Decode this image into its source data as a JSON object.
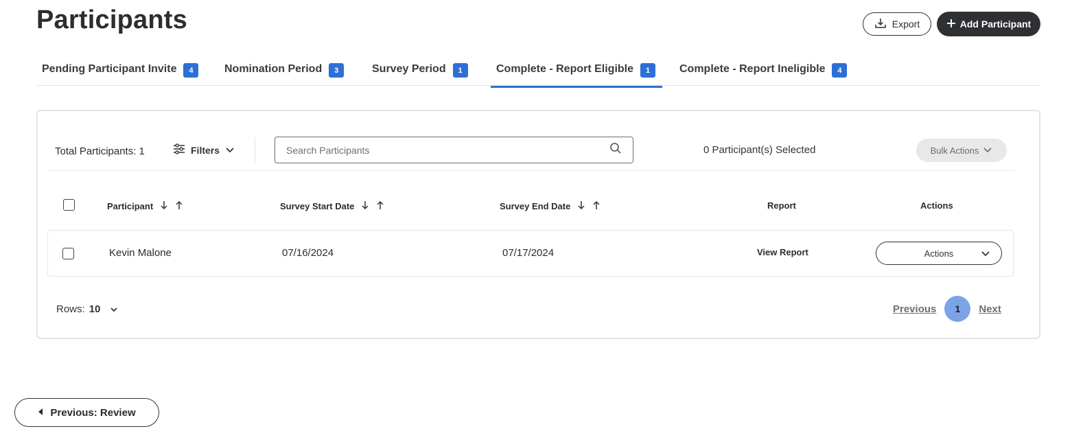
{
  "page": {
    "title": "Participants"
  },
  "header_actions": {
    "export_label": "Export",
    "add_label": "Add Participant"
  },
  "tabs": [
    {
      "label": "Pending Participant Invite",
      "count": "4",
      "active": false
    },
    {
      "label": "Nomination Period",
      "count": "3",
      "active": false
    },
    {
      "label": "Survey Period",
      "count": "1",
      "active": false
    },
    {
      "label": "Complete - Report Eligible",
      "count": "1",
      "active": true
    },
    {
      "label": "Complete - Report Ineligible",
      "count": "4",
      "active": false
    }
  ],
  "toolbar": {
    "total_label": "Total Participants: 1",
    "filters_label": "Filters",
    "search_placeholder": "Search Participants",
    "selected_label": "0 Participant(s) Selected",
    "bulk_label": "Bulk Actions"
  },
  "table": {
    "columns": {
      "participant": "Participant",
      "start": "Survey Start Date",
      "end": "Survey End Date",
      "report": "Report",
      "actions": "Actions"
    },
    "rows": [
      {
        "participant": "Kevin Malone",
        "start": "07/16/2024",
        "end": "07/17/2024",
        "report": "View Report",
        "actions": "Actions"
      }
    ]
  },
  "pagination": {
    "rows_label": "Rows:",
    "rows_value": "10",
    "previous": "Previous",
    "current_page": "1",
    "next": "Next"
  },
  "footer": {
    "prev_label": "Previous: Review"
  },
  "colors": {
    "accent": "#2d6fd6",
    "primary_dark": "#2f3034",
    "page_active": "#7ba4e8"
  }
}
